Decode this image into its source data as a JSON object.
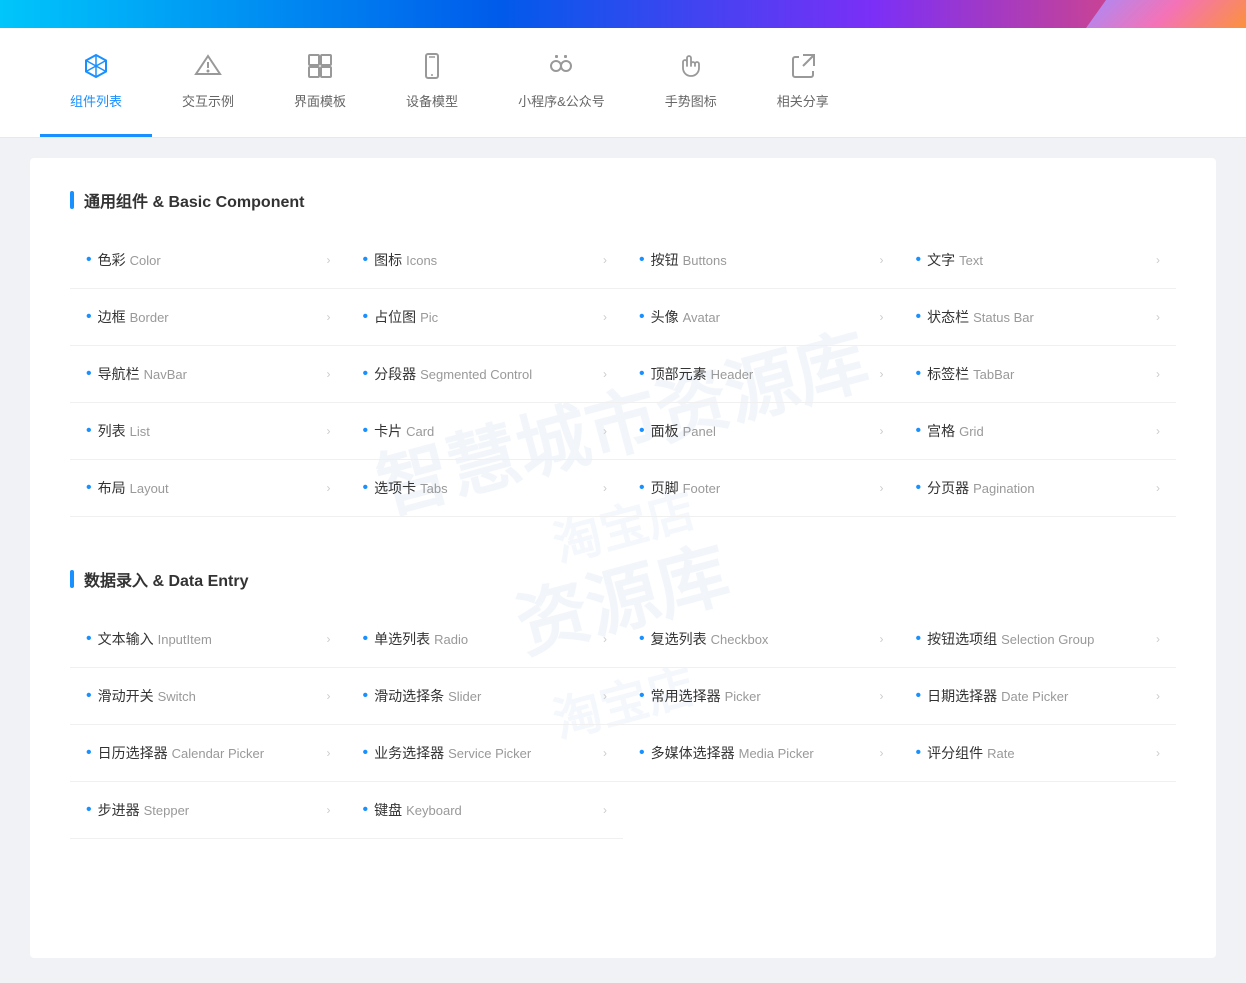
{
  "topBar": {
    "label": "top-gradient-bar"
  },
  "nav": {
    "tabs": [
      {
        "id": "components",
        "icon": "✕",
        "iconType": "cross",
        "label": "组件列表",
        "active": true
      },
      {
        "id": "interaction",
        "icon": "△",
        "iconType": "triangle",
        "label": "交互示例",
        "active": false
      },
      {
        "id": "templates",
        "icon": "⊞",
        "iconType": "grid",
        "label": "界面模板",
        "active": false
      },
      {
        "id": "devices",
        "icon": "☐",
        "iconType": "phone",
        "label": "设备模型",
        "active": false
      },
      {
        "id": "miniapp",
        "icon": "⊙",
        "iconType": "mini",
        "label": "小程序&公众号",
        "active": false
      },
      {
        "id": "gesture",
        "icon": "✋",
        "iconType": "hand",
        "label": "手势图标",
        "active": false
      },
      {
        "id": "share",
        "icon": "⚑",
        "iconType": "flag",
        "label": "相关分享",
        "active": false
      }
    ]
  },
  "sections": [
    {
      "id": "basic",
      "title": "通用组件 & Basic Component",
      "items": [
        {
          "id": "color",
          "zh": "色彩",
          "en": "Color"
        },
        {
          "id": "icons",
          "zh": "图标",
          "en": "Icons"
        },
        {
          "id": "buttons",
          "zh": "按钮",
          "en": "Buttons"
        },
        {
          "id": "text",
          "zh": "文字",
          "en": "Text"
        },
        {
          "id": "border",
          "zh": "边框",
          "en": "Border"
        },
        {
          "id": "pic",
          "zh": "占位图",
          "en": "Pic"
        },
        {
          "id": "avatar",
          "zh": "头像",
          "en": "Avatar"
        },
        {
          "id": "statusbar",
          "zh": "状态栏",
          "en": "Status Bar"
        },
        {
          "id": "navbar",
          "zh": "导航栏",
          "en": "NavBar"
        },
        {
          "id": "segmented",
          "zh": "分段器",
          "en": "Segmented Control"
        },
        {
          "id": "header",
          "zh": "顶部元素",
          "en": "Header"
        },
        {
          "id": "tabbar",
          "zh": "标签栏",
          "en": "TabBar"
        },
        {
          "id": "list",
          "zh": "列表",
          "en": "List"
        },
        {
          "id": "card",
          "zh": "卡片",
          "en": "Card"
        },
        {
          "id": "panel",
          "zh": "面板",
          "en": "Panel"
        },
        {
          "id": "grid",
          "zh": "宫格",
          "en": "Grid"
        },
        {
          "id": "layout",
          "zh": "布局",
          "en": "Layout"
        },
        {
          "id": "tabs",
          "zh": "选项卡",
          "en": "Tabs"
        },
        {
          "id": "footer",
          "zh": "页脚",
          "en": "Footer"
        },
        {
          "id": "pagination",
          "zh": "分页器",
          "en": "Pagination"
        }
      ]
    },
    {
      "id": "dataentry",
      "title": "数据录入 & Data Entry",
      "items": [
        {
          "id": "inputitem",
          "zh": "文本输入",
          "en": "InputItem"
        },
        {
          "id": "radio",
          "zh": "单选列表",
          "en": "Radio"
        },
        {
          "id": "checkbox",
          "zh": "复选列表",
          "en": "Checkbox"
        },
        {
          "id": "selectiongroup",
          "zh": "按钮选项组",
          "en": "Selection Group"
        },
        {
          "id": "switch",
          "zh": "滑动开关",
          "en": "Switch"
        },
        {
          "id": "slider",
          "zh": "滑动选择条",
          "en": "Slider"
        },
        {
          "id": "picker",
          "zh": "常用选择器",
          "en": "Picker"
        },
        {
          "id": "datepicker",
          "zh": "日期选择器",
          "en": "Date Picker"
        },
        {
          "id": "calendarpicker",
          "zh": "日历选择器",
          "en": "Calendar Picker"
        },
        {
          "id": "servicepicker",
          "zh": "业务选择器",
          "en": "Service Picker"
        },
        {
          "id": "mediapicker",
          "zh": "多媒体选择器",
          "en": "Media Picker"
        },
        {
          "id": "rate",
          "zh": "评分组件",
          "en": "Rate"
        },
        {
          "id": "stepper",
          "zh": "步进器",
          "en": "Stepper"
        },
        {
          "id": "keyboard",
          "zh": "键盘",
          "en": "Keyboard"
        }
      ]
    }
  ],
  "watermark": {
    "line1": "智慧城市资源库",
    "line2": "淘宝店"
  }
}
